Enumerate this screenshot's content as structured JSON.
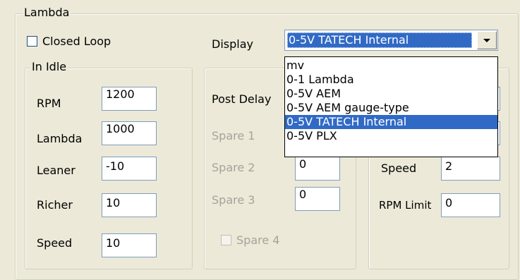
{
  "lambda_group": {
    "title": "Lambda"
  },
  "closed_loop": {
    "label": "Closed Loop",
    "checked": false
  },
  "display": {
    "label": "Display",
    "selected": "0-5V TATECH Internal",
    "options": [
      "mv",
      "0-1 Lambda",
      "0-5V AEM",
      "0-5V AEM gauge-type",
      "0-5V TATECH Internal",
      "0-5V PLX"
    ],
    "selected_index": 4
  },
  "in_idle": {
    "title": "In Idle",
    "rpm": {
      "label": "RPM",
      "value": "1200"
    },
    "lambda": {
      "label": "Lambda",
      "value": "1000"
    },
    "leaner": {
      "label": "Leaner",
      "value": "-10"
    },
    "richer": {
      "label": "Richer",
      "value": "10"
    },
    "speed": {
      "label": "Speed",
      "value": "10"
    }
  },
  "middle": {
    "post_delay": {
      "label": "Post Delay"
    },
    "spare1": {
      "label": "Spare 1"
    },
    "spare2": {
      "label": "Spare 2",
      "value": "0"
    },
    "spare3": {
      "label": "Spare 3",
      "value": "0"
    },
    "spare4": {
      "label": "Spare 4",
      "checked": false
    }
  },
  "right": {
    "speed": {
      "label": "Speed",
      "value": "2"
    },
    "rpm_limit": {
      "label": "RPM Limit",
      "value": "0"
    }
  },
  "colors": {
    "selection": "#316ac5",
    "dialog_bg": "#ece9d8"
  }
}
